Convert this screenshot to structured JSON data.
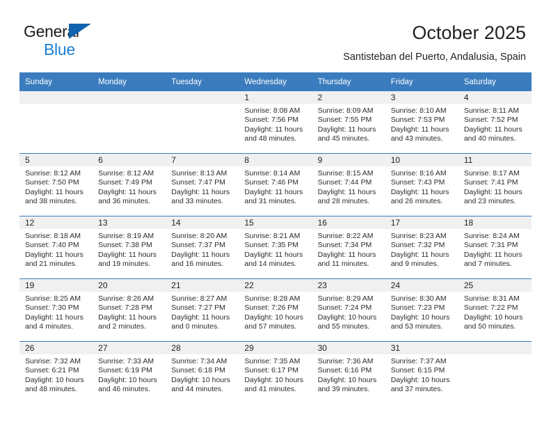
{
  "brand": {
    "name_top": "General",
    "name_bottom": "Blue",
    "logo_icon": "triangle-flag-icon",
    "color_dark": "#1a1a1a",
    "color_blue": "#1a7fd4",
    "color_triangle": "#1263ad"
  },
  "header": {
    "title": "October 2025",
    "subtitle": "Santisteban del Puerto, Andalusia, Spain"
  },
  "theme": {
    "header_bg": "#3a7cbe",
    "header_text": "#ffffff",
    "daynum_band_bg": "#f0f0f0",
    "cell_bg": "#ffffff",
    "row_divider": "#3a7cbe"
  },
  "calendar": {
    "weekday_headers": [
      "Sunday",
      "Monday",
      "Tuesday",
      "Wednesday",
      "Thursday",
      "Friday",
      "Saturday"
    ],
    "weeks": [
      [
        {
          "day": "",
          "blank": true,
          "lines": []
        },
        {
          "day": "",
          "blank": true,
          "lines": []
        },
        {
          "day": "",
          "blank": true,
          "lines": []
        },
        {
          "day": "1",
          "blank": false,
          "lines": [
            "Sunrise: 8:08 AM",
            "Sunset: 7:56 PM",
            "Daylight: 11 hours",
            "and 48 minutes."
          ]
        },
        {
          "day": "2",
          "blank": false,
          "lines": [
            "Sunrise: 8:09 AM",
            "Sunset: 7:55 PM",
            "Daylight: 11 hours",
            "and 45 minutes."
          ]
        },
        {
          "day": "3",
          "blank": false,
          "lines": [
            "Sunrise: 8:10 AM",
            "Sunset: 7:53 PM",
            "Daylight: 11 hours",
            "and 43 minutes."
          ]
        },
        {
          "day": "4",
          "blank": false,
          "lines": [
            "Sunrise: 8:11 AM",
            "Sunset: 7:52 PM",
            "Daylight: 11 hours",
            "and 40 minutes."
          ]
        }
      ],
      [
        {
          "day": "5",
          "blank": false,
          "lines": [
            "Sunrise: 8:12 AM",
            "Sunset: 7:50 PM",
            "Daylight: 11 hours",
            "and 38 minutes."
          ]
        },
        {
          "day": "6",
          "blank": false,
          "lines": [
            "Sunrise: 8:12 AM",
            "Sunset: 7:49 PM",
            "Daylight: 11 hours",
            "and 36 minutes."
          ]
        },
        {
          "day": "7",
          "blank": false,
          "lines": [
            "Sunrise: 8:13 AM",
            "Sunset: 7:47 PM",
            "Daylight: 11 hours",
            "and 33 minutes."
          ]
        },
        {
          "day": "8",
          "blank": false,
          "lines": [
            "Sunrise: 8:14 AM",
            "Sunset: 7:46 PM",
            "Daylight: 11 hours",
            "and 31 minutes."
          ]
        },
        {
          "day": "9",
          "blank": false,
          "lines": [
            "Sunrise: 8:15 AM",
            "Sunset: 7:44 PM",
            "Daylight: 11 hours",
            "and 28 minutes."
          ]
        },
        {
          "day": "10",
          "blank": false,
          "lines": [
            "Sunrise: 8:16 AM",
            "Sunset: 7:43 PM",
            "Daylight: 11 hours",
            "and 26 minutes."
          ]
        },
        {
          "day": "11",
          "blank": false,
          "lines": [
            "Sunrise: 8:17 AM",
            "Sunset: 7:41 PM",
            "Daylight: 11 hours",
            "and 23 minutes."
          ]
        }
      ],
      [
        {
          "day": "12",
          "blank": false,
          "lines": [
            "Sunrise: 8:18 AM",
            "Sunset: 7:40 PM",
            "Daylight: 11 hours",
            "and 21 minutes."
          ]
        },
        {
          "day": "13",
          "blank": false,
          "lines": [
            "Sunrise: 8:19 AM",
            "Sunset: 7:38 PM",
            "Daylight: 11 hours",
            "and 19 minutes."
          ]
        },
        {
          "day": "14",
          "blank": false,
          "lines": [
            "Sunrise: 8:20 AM",
            "Sunset: 7:37 PM",
            "Daylight: 11 hours",
            "and 16 minutes."
          ]
        },
        {
          "day": "15",
          "blank": false,
          "lines": [
            "Sunrise: 8:21 AM",
            "Sunset: 7:35 PM",
            "Daylight: 11 hours",
            "and 14 minutes."
          ]
        },
        {
          "day": "16",
          "blank": false,
          "lines": [
            "Sunrise: 8:22 AM",
            "Sunset: 7:34 PM",
            "Daylight: 11 hours",
            "and 11 minutes."
          ]
        },
        {
          "day": "17",
          "blank": false,
          "lines": [
            "Sunrise: 8:23 AM",
            "Sunset: 7:32 PM",
            "Daylight: 11 hours",
            "and 9 minutes."
          ]
        },
        {
          "day": "18",
          "blank": false,
          "lines": [
            "Sunrise: 8:24 AM",
            "Sunset: 7:31 PM",
            "Daylight: 11 hours",
            "and 7 minutes."
          ]
        }
      ],
      [
        {
          "day": "19",
          "blank": false,
          "lines": [
            "Sunrise: 8:25 AM",
            "Sunset: 7:30 PM",
            "Daylight: 11 hours",
            "and 4 minutes."
          ]
        },
        {
          "day": "20",
          "blank": false,
          "lines": [
            "Sunrise: 8:26 AM",
            "Sunset: 7:28 PM",
            "Daylight: 11 hours",
            "and 2 minutes."
          ]
        },
        {
          "day": "21",
          "blank": false,
          "lines": [
            "Sunrise: 8:27 AM",
            "Sunset: 7:27 PM",
            "Daylight: 11 hours",
            "and 0 minutes."
          ]
        },
        {
          "day": "22",
          "blank": false,
          "lines": [
            "Sunrise: 8:28 AM",
            "Sunset: 7:26 PM",
            "Daylight: 10 hours",
            "and 57 minutes."
          ]
        },
        {
          "day": "23",
          "blank": false,
          "lines": [
            "Sunrise: 8:29 AM",
            "Sunset: 7:24 PM",
            "Daylight: 10 hours",
            "and 55 minutes."
          ]
        },
        {
          "day": "24",
          "blank": false,
          "lines": [
            "Sunrise: 8:30 AM",
            "Sunset: 7:23 PM",
            "Daylight: 10 hours",
            "and 53 minutes."
          ]
        },
        {
          "day": "25",
          "blank": false,
          "lines": [
            "Sunrise: 8:31 AM",
            "Sunset: 7:22 PM",
            "Daylight: 10 hours",
            "and 50 minutes."
          ]
        }
      ],
      [
        {
          "day": "26",
          "blank": false,
          "lines": [
            "Sunrise: 7:32 AM",
            "Sunset: 6:21 PM",
            "Daylight: 10 hours",
            "and 48 minutes."
          ]
        },
        {
          "day": "27",
          "blank": false,
          "lines": [
            "Sunrise: 7:33 AM",
            "Sunset: 6:19 PM",
            "Daylight: 10 hours",
            "and 46 minutes."
          ]
        },
        {
          "day": "28",
          "blank": false,
          "lines": [
            "Sunrise: 7:34 AM",
            "Sunset: 6:18 PM",
            "Daylight: 10 hours",
            "and 44 minutes."
          ]
        },
        {
          "day": "29",
          "blank": false,
          "lines": [
            "Sunrise: 7:35 AM",
            "Sunset: 6:17 PM",
            "Daylight: 10 hours",
            "and 41 minutes."
          ]
        },
        {
          "day": "30",
          "blank": false,
          "lines": [
            "Sunrise: 7:36 AM",
            "Sunset: 6:16 PM",
            "Daylight: 10 hours",
            "and 39 minutes."
          ]
        },
        {
          "day": "31",
          "blank": false,
          "lines": [
            "Sunrise: 7:37 AM",
            "Sunset: 6:15 PM",
            "Daylight: 10 hours",
            "and 37 minutes."
          ]
        },
        {
          "day": "",
          "blank": true,
          "lines": []
        }
      ]
    ]
  }
}
